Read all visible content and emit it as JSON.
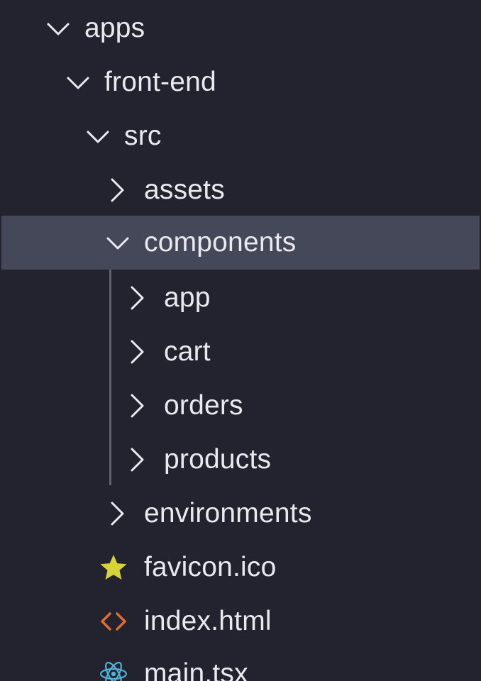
{
  "explorer": {
    "apps": {
      "label": "apps",
      "expanded": true
    },
    "front_end": {
      "label": "front-end",
      "expanded": true
    },
    "src": {
      "label": "src",
      "expanded": true
    },
    "assets": {
      "label": "assets",
      "expanded": false
    },
    "components": {
      "label": "components",
      "expanded": true,
      "selected": true
    },
    "app": {
      "label": "app",
      "expanded": false
    },
    "cart": {
      "label": "cart",
      "expanded": false
    },
    "orders": {
      "label": "orders",
      "expanded": false
    },
    "products": {
      "label": "products",
      "expanded": false
    },
    "environments": {
      "label": "environments",
      "expanded": false
    },
    "favicon": {
      "label": "favicon.ico",
      "icon": "star-icon"
    },
    "index_html": {
      "label": "index.html",
      "icon": "html-code-icon"
    },
    "main_tsx": {
      "label": "main.tsx",
      "icon": "react-icon"
    }
  },
  "colors": {
    "background": "#22232e",
    "selection": "#454859",
    "text": "#e9eaf0",
    "chevron": "#e9eaf0",
    "indent_guide": "#5e6172",
    "star_icon": "#d6d23a",
    "html_icon": "#e06c2e",
    "react_icon": "#4fb3d9"
  }
}
